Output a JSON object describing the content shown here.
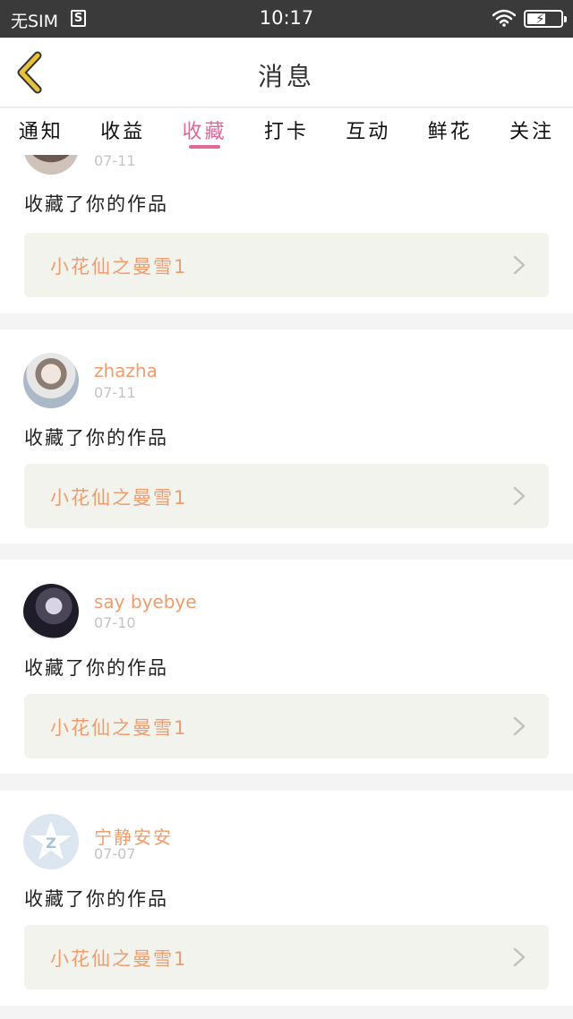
{
  "status_bar": {
    "carrier": "无SIM",
    "sim_icon_label": "S",
    "time": "10:17",
    "icons": [
      "sim-icon",
      "wifi-icon",
      "battery-charging-icon"
    ]
  },
  "nav": {
    "title": "消息",
    "back_icon": "chevron-left-icon"
  },
  "tabs": [
    {
      "label": "通知"
    },
    {
      "label": "收益"
    },
    {
      "label": "收藏",
      "active": true
    },
    {
      "label": "打卡"
    },
    {
      "label": "互动"
    },
    {
      "label": "鲜花"
    },
    {
      "label": "关注"
    }
  ],
  "colors": {
    "accent_pink": "#e0689a",
    "orange_text": "#ef9d6e",
    "date_gray": "#c4c4c4",
    "card_box": "#f3f3ee",
    "back_icon_yellow": "#e8c23a"
  },
  "messages": [
    {
      "username": "",
      "date": "07-11",
      "action": "收藏了你的作品",
      "work_title": "小花仙之曼雪1"
    },
    {
      "username": "zhazha",
      "date": "07-11",
      "action": "收藏了你的作品",
      "work_title": "小花仙之曼雪1"
    },
    {
      "username": "say byebye",
      "date": "07-10",
      "action": "收藏了你的作品",
      "work_title": "小花仙之曼雪1"
    },
    {
      "username": "宁静安安",
      "date": "07-07",
      "action": "收藏了你的作品",
      "work_title": "小花仙之曼雪1"
    }
  ]
}
